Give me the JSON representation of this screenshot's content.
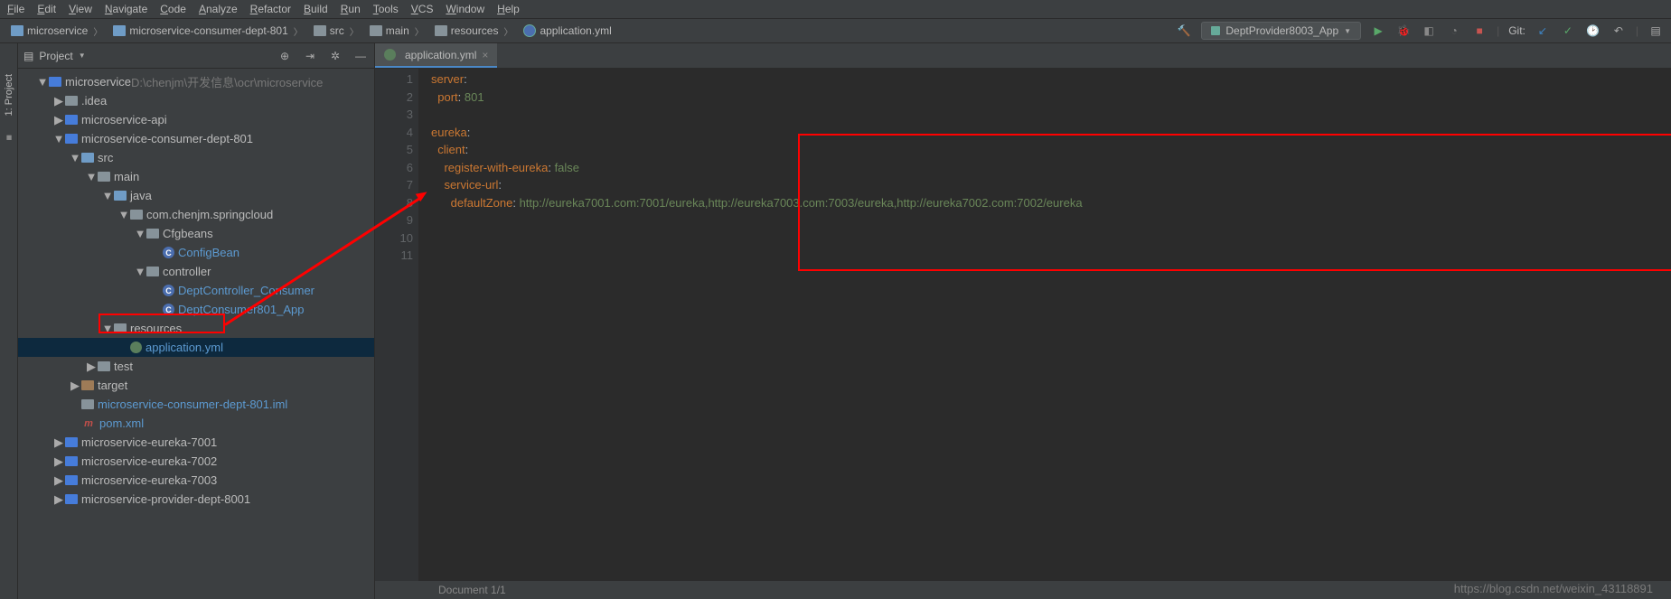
{
  "menu": [
    "File",
    "Edit",
    "View",
    "Navigate",
    "Code",
    "Analyze",
    "Refactor",
    "Build",
    "Run",
    "Tools",
    "VCS",
    "Window",
    "Help"
  ],
  "breadcrumbs": [
    {
      "label": "microservice",
      "icon": "module"
    },
    {
      "label": "microservice-consumer-dept-801",
      "icon": "module"
    },
    {
      "label": "src",
      "icon": "folder"
    },
    {
      "label": "main",
      "icon": "folder"
    },
    {
      "label": "resources",
      "icon": "folder"
    },
    {
      "label": "application.yml",
      "icon": "cfg"
    }
  ],
  "runConfig": "DeptProvider8003_App",
  "gitLabel": "Git:",
  "sidebarTab": "1: Project",
  "panelTitle": "Project",
  "tree": [
    {
      "d": 0,
      "t": "down",
      "i": "module",
      "l": "microservice",
      "extra": "D:\\chenjm\\开发信息\\ocr\\microservice",
      "blue": false
    },
    {
      "d": 1,
      "t": "right",
      "i": "folder",
      "l": ".idea",
      "blue": false
    },
    {
      "d": 1,
      "t": "right",
      "i": "module",
      "l": "microservice-api",
      "blue": false
    },
    {
      "d": 1,
      "t": "down",
      "i": "module",
      "l": "microservice-consumer-dept-801",
      "blue": false
    },
    {
      "d": 2,
      "t": "down",
      "i": "folder-blue",
      "l": "src",
      "blue": false
    },
    {
      "d": 3,
      "t": "down",
      "i": "folder",
      "l": "main",
      "blue": false
    },
    {
      "d": 4,
      "t": "down",
      "i": "folder-blue",
      "l": "java",
      "blue": false
    },
    {
      "d": 5,
      "t": "down",
      "i": "folder",
      "l": "com.chenjm.springcloud",
      "blue": false
    },
    {
      "d": 6,
      "t": "down",
      "i": "folder",
      "l": "Cfgbeans",
      "blue": false
    },
    {
      "d": 7,
      "t": "",
      "i": "class",
      "l": "ConfigBean",
      "blue": true
    },
    {
      "d": 6,
      "t": "down",
      "i": "folder",
      "l": "controller",
      "blue": false
    },
    {
      "d": 7,
      "t": "",
      "i": "class",
      "l": "DeptController_Consumer",
      "blue": true
    },
    {
      "d": 7,
      "t": "",
      "i": "class",
      "l": "DeptConsumer801_App",
      "blue": true
    },
    {
      "d": 4,
      "t": "down",
      "i": "folder",
      "l": "resources",
      "blue": false
    },
    {
      "d": 5,
      "t": "",
      "i": "cfg",
      "l": "application.yml",
      "blue": true,
      "sel": true
    },
    {
      "d": 3,
      "t": "right",
      "i": "folder",
      "l": "test",
      "blue": false
    },
    {
      "d": 2,
      "t": "right",
      "i": "folder-orange",
      "l": "target",
      "blue": false
    },
    {
      "d": 2,
      "t": "",
      "i": "file",
      "l": "microservice-consumer-dept-801.iml",
      "blue": true
    },
    {
      "d": 2,
      "t": "",
      "i": "mvn",
      "l": "pom.xml",
      "blue": true
    },
    {
      "d": 1,
      "t": "right",
      "i": "module",
      "l": "microservice-eureka-7001",
      "blue": false
    },
    {
      "d": 1,
      "t": "right",
      "i": "module",
      "l": "microservice-eureka-7002",
      "blue": false
    },
    {
      "d": 1,
      "t": "right",
      "i": "module",
      "l": "microservice-eureka-7003",
      "blue": false
    },
    {
      "d": 1,
      "t": "right",
      "i": "module",
      "l": "microservice-provider-dept-8001",
      "blue": false
    }
  ],
  "tab": {
    "label": "application.yml"
  },
  "code": {
    "lines": [
      1,
      2,
      3,
      4,
      5,
      6,
      7,
      8,
      9,
      10,
      11
    ],
    "text": [
      "server:",
      "  port: 801",
      "",
      "eureka:",
      "  client:",
      "    register-with-eureka: false",
      "    service-url:",
      "      defaultZone: http://eureka7001.com:7001/eureka,http://eureka7003.com:7003/eureka,http://eureka7002.com:7002/eureka",
      "",
      "",
      ""
    ]
  },
  "status": "Document 1/1",
  "watermark": "https://blog.csdn.net/weixin_43118891"
}
